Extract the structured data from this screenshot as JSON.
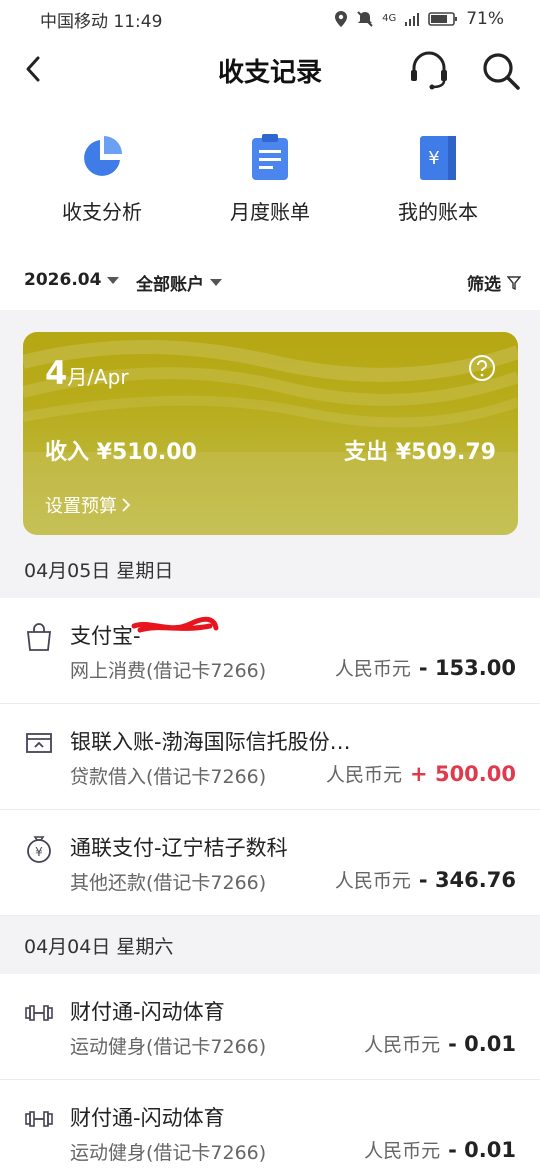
{
  "status": {
    "carrier_time": "中国移动 11:49",
    "battery": "71%",
    "net": "4G"
  },
  "nav": {
    "title": "收支记录"
  },
  "quick": [
    {
      "label": "收支分析",
      "icon": "pie-chart-icon"
    },
    {
      "label": "月度账单",
      "icon": "clipboard-icon"
    },
    {
      "label": "我的账本",
      "icon": "ledger-book-icon"
    }
  ],
  "filter": {
    "month": "2026.04",
    "account": "全部账户",
    "screen": "筛选"
  },
  "banner": {
    "month_num": "4",
    "month_unit": "月/Apr",
    "income": "收入 ¥510.00",
    "expense": "支出 ¥509.79",
    "budget": "设置预算"
  },
  "groups": [
    {
      "date": "04月05日  星期日",
      "items": [
        {
          "name": "支付宝-",
          "sub": "网上消费(借记卡7266)",
          "currency": "人民币元",
          "amount": "- 153.00",
          "icon": "shopping-bag-icon"
        },
        {
          "name": "银联入账-渤海国际信托股份…",
          "sub": "贷款借入(借记卡7266)",
          "currency": "人民币元",
          "amount": "+ 500.00",
          "icon": "transfer-in-icon"
        },
        {
          "name": "通联支付-辽宁桔子数科",
          "sub": "其他还款(借记卡7266)",
          "currency": "人民币元",
          "amount": "- 346.76",
          "icon": "money-bag-icon"
        }
      ]
    },
    {
      "date": "04月04日  星期六",
      "items": [
        {
          "name": "财付通-闪动体育",
          "sub": "运动健身(借记卡7266)",
          "currency": "人民币元",
          "amount": "- 0.01",
          "icon": "dumbbell-icon"
        },
        {
          "name": "财付通-闪动体育",
          "sub": "运动健身(借记卡7266)",
          "currency": "人民币元",
          "amount": "- 0.01",
          "icon": "dumbbell-icon"
        }
      ]
    }
  ],
  "colors": {
    "positive": "#e03a4f",
    "accent": "#3f7ce8",
    "banner": "#b8ac1a"
  }
}
